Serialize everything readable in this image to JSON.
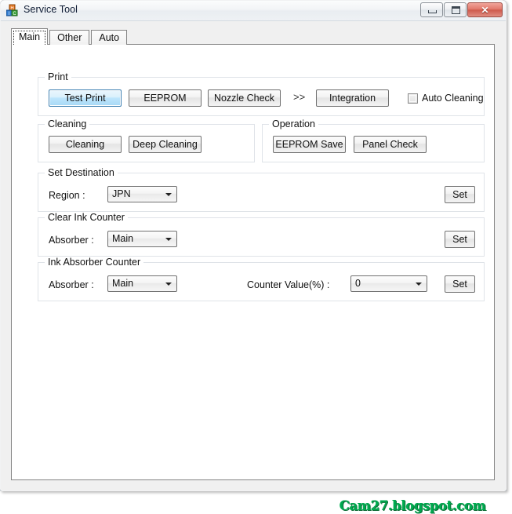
{
  "window": {
    "title": "Service Tool",
    "icon": "blocks-icon",
    "buttons": {
      "minimize": "minimize-icon",
      "maximize": "maximize-icon",
      "close": "✕"
    }
  },
  "tabs": [
    {
      "label": "Main",
      "selected": true
    },
    {
      "label": "Other",
      "selected": false
    },
    {
      "label": "Auto",
      "selected": false
    }
  ],
  "groups": {
    "print": {
      "label": "Print",
      "buttons": [
        {
          "label": "Test Print",
          "state": "focused"
        },
        {
          "label": "EEPROM",
          "state": "normal"
        },
        {
          "label": "Nozzle Check",
          "state": "normal"
        },
        {
          "label": "Integration",
          "state": "normal"
        }
      ],
      "separator": ">>",
      "checkbox": {
        "label": "Auto Cleaning",
        "checked": false
      }
    },
    "cleaning": {
      "label": "Cleaning",
      "buttons": [
        {
          "label": "Cleaning"
        },
        {
          "label": "Deep Cleaning"
        }
      ]
    },
    "operation": {
      "label": "Operation",
      "buttons": [
        {
          "label": "EEPROM Save"
        },
        {
          "label": "Panel Check"
        }
      ]
    },
    "set_destination": {
      "label": "Set Destination",
      "field_label": "Region :",
      "combo_value": "JPN",
      "set_label": "Set"
    },
    "clear_ink_counter": {
      "label": "Clear Ink Counter",
      "field_label": "Absorber :",
      "combo_value": "Main",
      "set_label": "Set"
    },
    "ink_absorber_counter": {
      "label": "Ink Absorber Counter",
      "field_label": "Absorber :",
      "combo_value": "Main",
      "counter_label": "Counter Value(%) :",
      "counter_value": "0",
      "set_label": "Set"
    }
  },
  "watermark": {
    "text": "Cam27.blogspot.com",
    "color": "#00a84f"
  }
}
